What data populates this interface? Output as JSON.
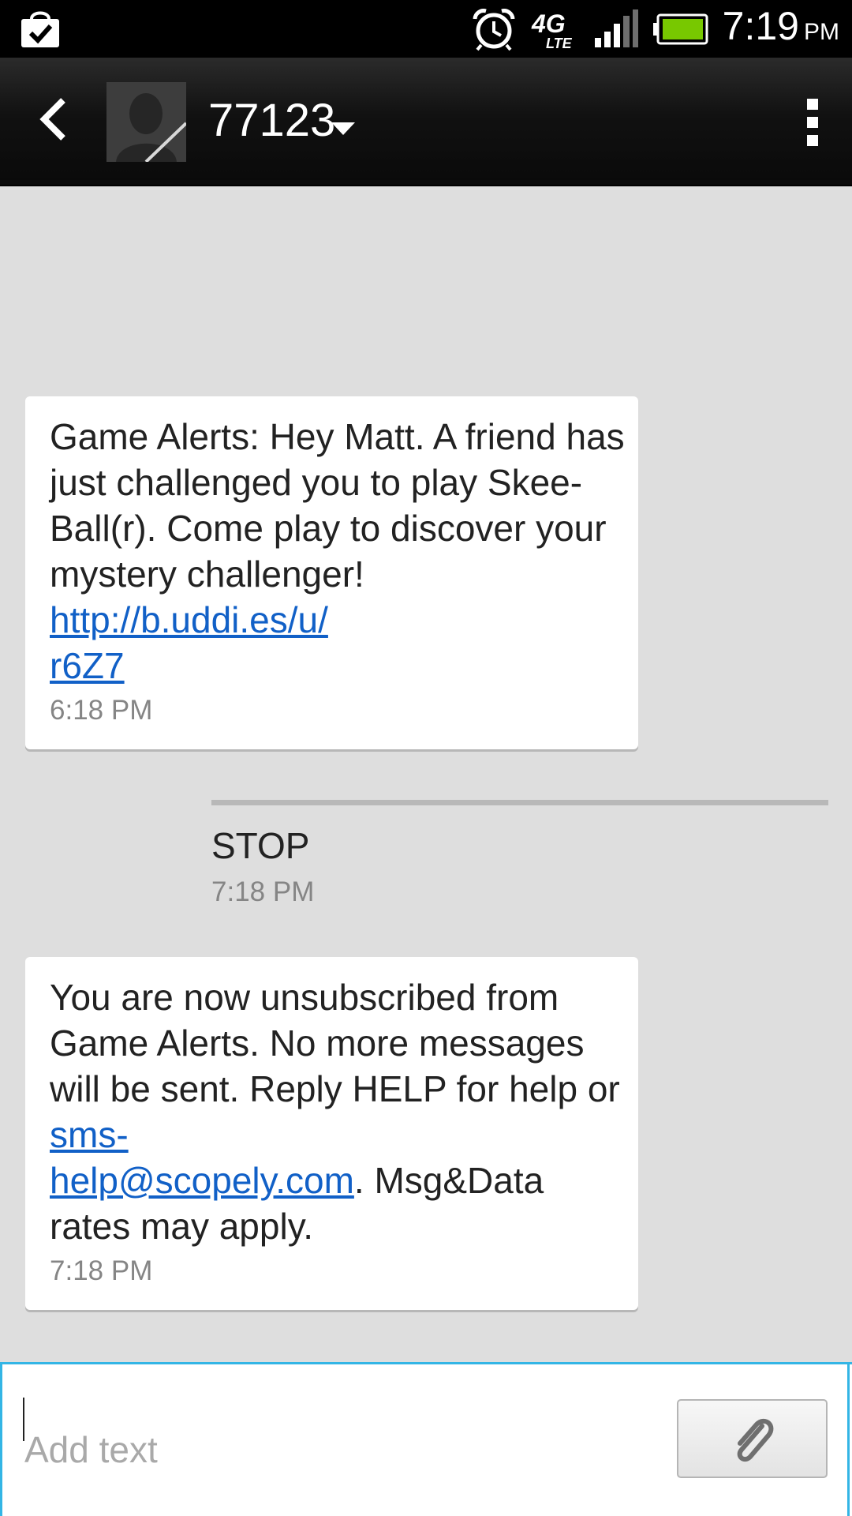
{
  "status_bar": {
    "time": "7:19",
    "ampm": "PM",
    "network_label": "4G LTE",
    "icons": [
      "shopping-bag-check-icon",
      "alarm-clock-icon",
      "4g-lte-icon",
      "signal-icon",
      "battery-icon"
    ]
  },
  "header": {
    "contact": "77123"
  },
  "messages": [
    {
      "direction": "received",
      "text_before": "Game Alerts: Hey Matt. A friend has just challenged you to play Skee-Ball(r). Come play to discover your mystery challenger! ",
      "link_line1": "http://b.uddi.es/u/",
      "link_line2": "r6Z7",
      "time": "6:18 PM"
    },
    {
      "direction": "sent",
      "text": "STOP",
      "time": "7:18 PM"
    },
    {
      "direction": "received",
      "text_before": "You are now unsubscribed from Game Alerts. No more messages will be sent. Reply HELP for help or ",
      "link_line1": "sms-",
      "link_line2": "help@scopely.com",
      "text_after": ". Msg&Data rates may apply.",
      "time": "7:18 PM"
    }
  ],
  "compose": {
    "placeholder": "Add text",
    "value": ""
  },
  "colors": {
    "accent": "#33b5e5",
    "link": "#1160c7",
    "battery": "#78c800",
    "background": "#dedede"
  }
}
